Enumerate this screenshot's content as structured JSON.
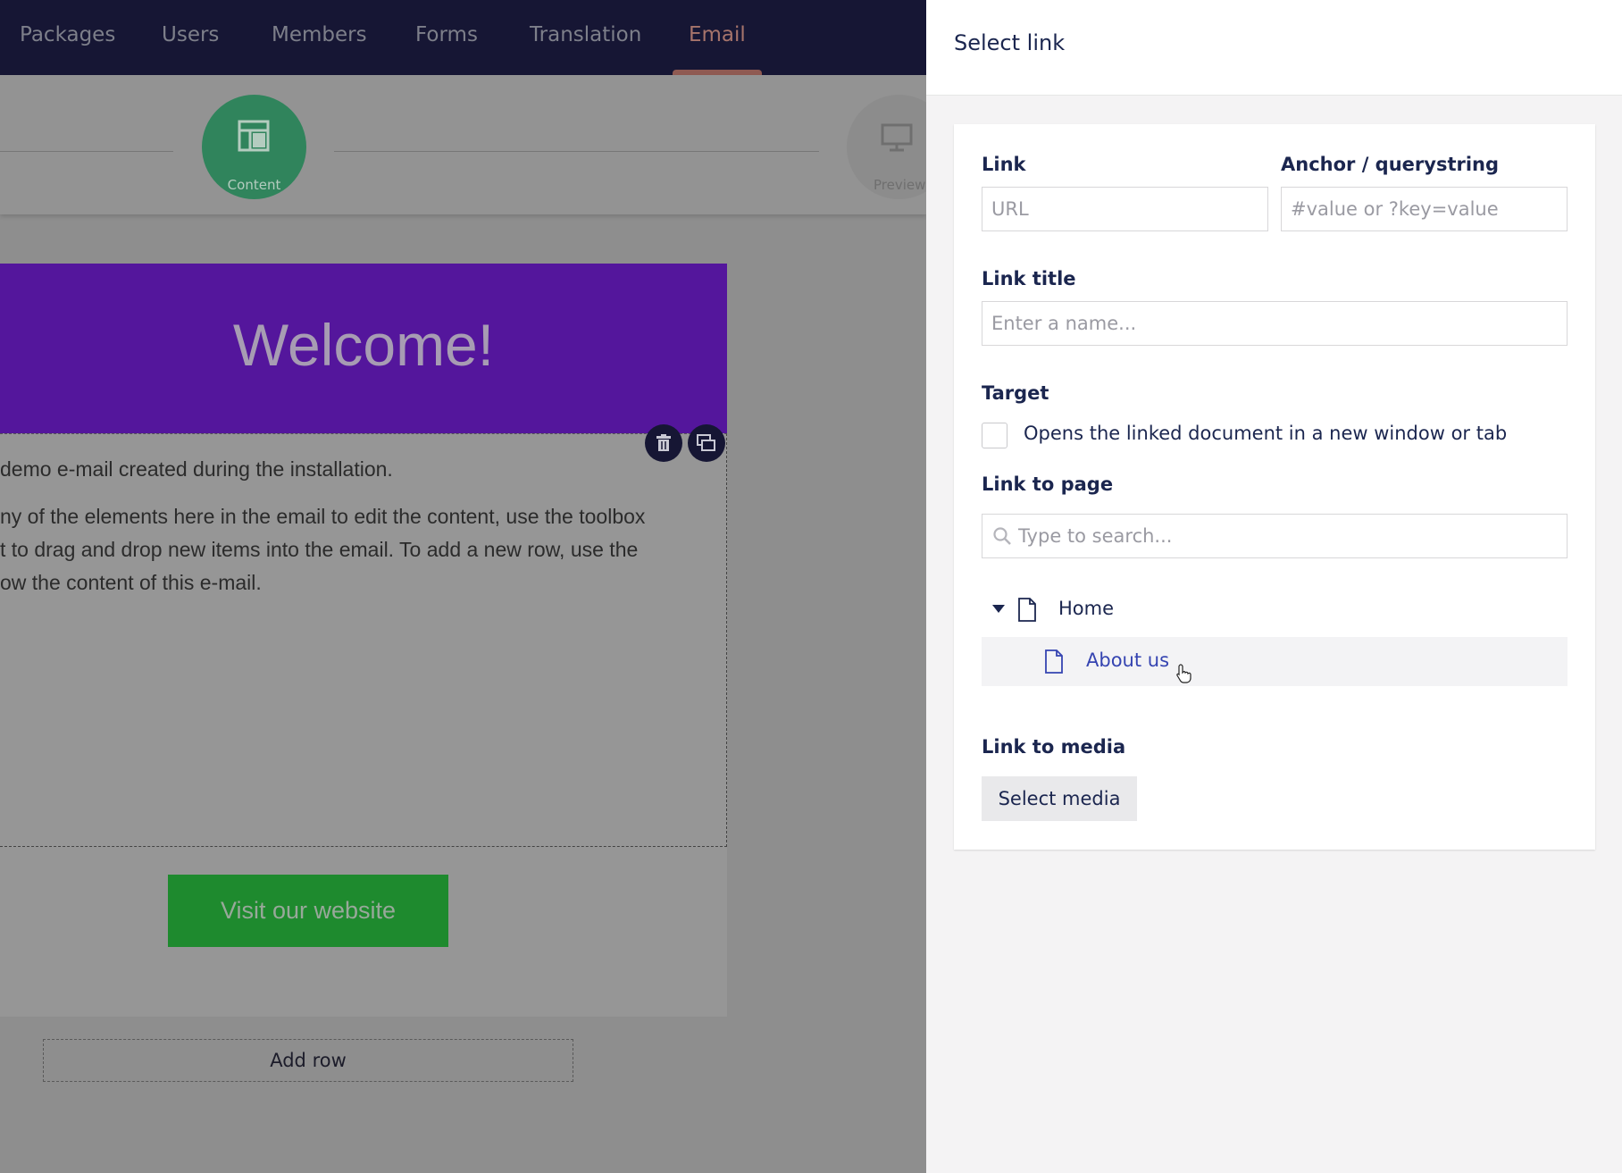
{
  "topnav": {
    "items": [
      {
        "label": "Packages"
      },
      {
        "label": "Users"
      },
      {
        "label": "Members"
      },
      {
        "label": "Forms"
      },
      {
        "label": "Translation"
      },
      {
        "label": "Email",
        "active": true
      }
    ]
  },
  "steps": {
    "content_label": "Content",
    "preview_label": "Preview"
  },
  "email": {
    "banner_text": "Welcome!",
    "para1": "demo e-mail created during the installation.",
    "para2_line1": "ny of the elements here in the email to edit the content, use the toolbox",
    "para2_line2": "t to drag and drop new items into the email. To add a new row, use the",
    "para2_line3": "ow the content of this e-mail.",
    "button_text": "Visit our website",
    "add_row_label": "Add row"
  },
  "panel": {
    "title": "Select link",
    "link_label": "Link",
    "link_placeholder": "URL",
    "anchor_label": "Anchor / querystring",
    "anchor_placeholder": "#value or ?key=value",
    "title_label": "Link title",
    "title_placeholder": "Enter a name...",
    "target_label": "Target",
    "target_checkbox_label": "Opens the linked document in a new window or tab",
    "link_to_page_label": "Link to page",
    "search_placeholder": "Type to search...",
    "tree": [
      {
        "label": "Home",
        "expanded": true
      },
      {
        "label": "About us",
        "hovered": true
      }
    ],
    "link_to_media_label": "Link to media",
    "select_media_label": "Select media"
  },
  "colors": {
    "nav_bg": "#161634",
    "banner_bg": "#54169c",
    "button_bg": "#1e8a2e",
    "content_step": "#30845c",
    "link_text": "#3544b1"
  }
}
